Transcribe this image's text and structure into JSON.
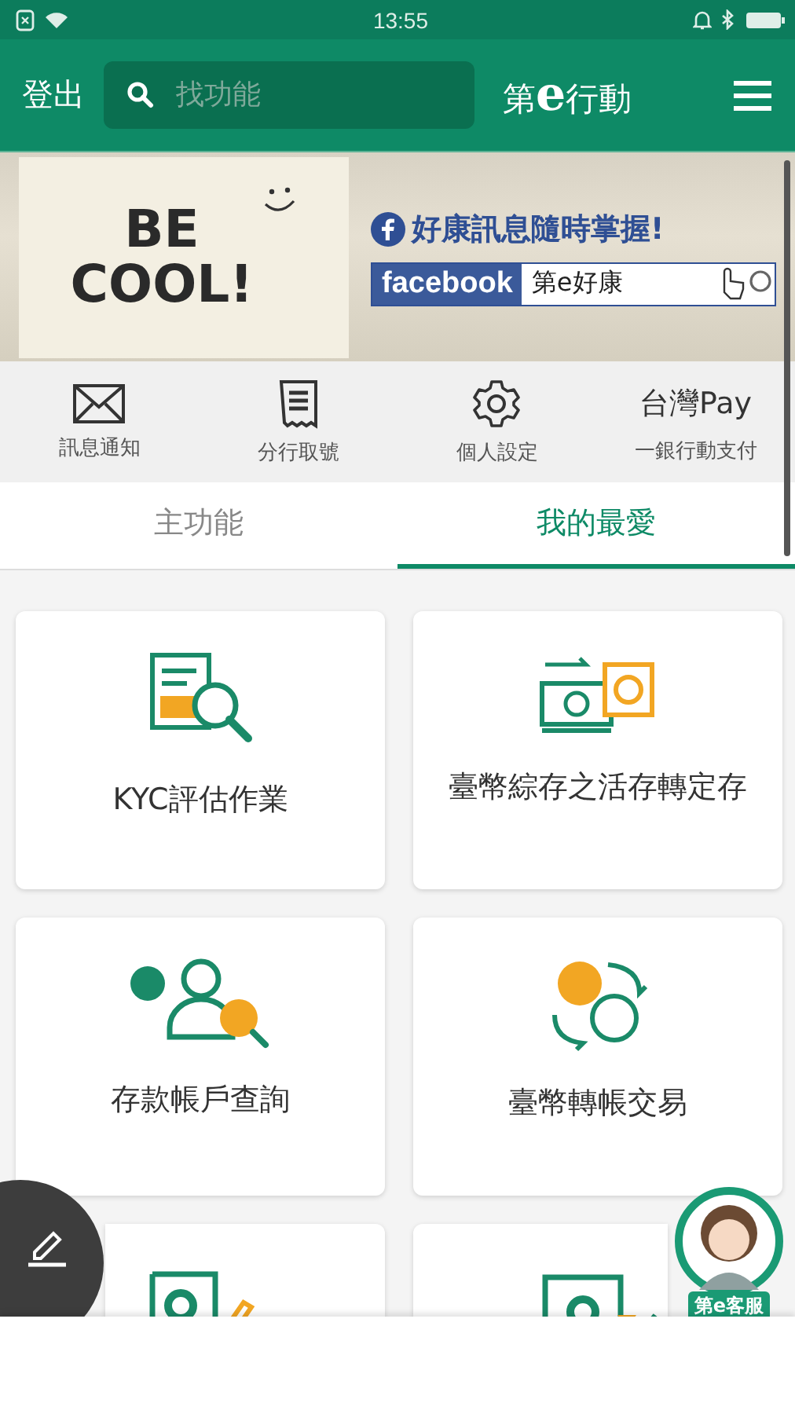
{
  "status_bar": {
    "time": "13:55"
  },
  "header": {
    "logout": "登出",
    "search": {
      "placeholder": "找功能"
    },
    "logo": "第**e**行動"
  },
  "banner": {
    "headline": "BE COOL!",
    "tagline": "好康訊息隨時掌握!",
    "fb_label": "facebook",
    "fb_page": "第e好康"
  },
  "shortcuts": [
    {
      "kind": "mail",
      "label": "訊息通知"
    },
    {
      "kind": "ticket",
      "label": "分行取號"
    },
    {
      "kind": "gear",
      "label": "個人設定"
    },
    {
      "kind": "logo",
      "logo": "台灣Pay",
      "label": "一銀行動支付"
    }
  ],
  "tabs": [
    {
      "label": "主功能",
      "selected": false
    },
    {
      "label": "我的最愛",
      "selected": true
    }
  ],
  "cards": [
    {
      "kind": "kyc",
      "label": "KYC評估作業"
    },
    {
      "kind": "deposit",
      "label": "臺幣綜存之活存轉定存"
    },
    {
      "kind": "account",
      "label": "存款帳戶查詢"
    },
    {
      "kind": "transfer",
      "label": "臺幣轉帳交易"
    },
    {
      "kind": "edoc"
    },
    {
      "kind": "ebill"
    }
  ],
  "customer_service": {
    "label": "第e客服"
  }
}
